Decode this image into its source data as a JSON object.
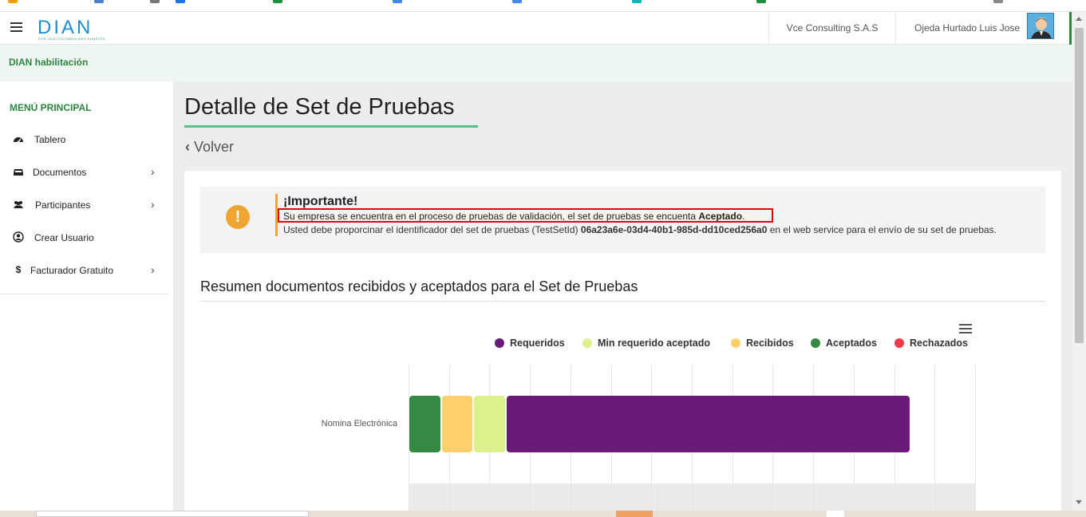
{
  "colors": {
    "brand_green": "#2e8540",
    "accent_teal": "#4ec28a",
    "warning_orange": "#f0a533",
    "highlight_red": "#e0060f"
  },
  "header": {
    "logo_text": "DIAN",
    "logo_tagline": "POR UNA COLOMBIA MÁS HONESTA",
    "company": "Vce Consulting S.A.S",
    "user": "Ojeda Hurtado Luis Jose",
    "menu_icon": "hamburger-icon",
    "avatar_icon": "user-avatar-icon"
  },
  "environment": "DIAN habilitación",
  "sidebar": {
    "title": "MENÚ PRINCIPAL",
    "items": [
      {
        "label": "Tablero",
        "icon": "dashboard-icon",
        "has_submenu": false
      },
      {
        "label": "Documentos",
        "icon": "inbox-icon",
        "has_submenu": true
      },
      {
        "label": "Participantes",
        "icon": "users-icon",
        "has_submenu": true
      },
      {
        "label": "Crear Usuario",
        "icon": "user-circle-icon",
        "has_submenu": false
      },
      {
        "label": "Facturador Gratuito",
        "icon": "dollar-icon",
        "has_submenu": true
      }
    ]
  },
  "main": {
    "title": "Detalle de Set de Pruebas",
    "back_label": "Volver",
    "alert": {
      "icon": "exclamation-icon",
      "title": "¡Importante!",
      "line1_text": "Su empresa se encuentra en el proceso de pruebas de validación, el set de pruebas se encuenta ",
      "line1_status": "Aceptado",
      "line1_end": ".",
      "line2_text": "Usted debe proporcinar el identificador del set de pruebas (TestSetId) ",
      "line2_id": "06a23a6e-03d4-40b1-985d-dd10ced256a0",
      "line2_end": " en el web service para el envío de su set de pruebas."
    },
    "summary_title": "Resumen documentos recibidos y aceptados para el Set de Pruebas",
    "chart_menu_icon": "chart-menu-icon"
  },
  "chart_data": {
    "type": "bar",
    "orientation": "horizontal",
    "stacked": true,
    "categories": [
      "Nomina Electrónica"
    ],
    "series": [
      {
        "name": "Requeridos",
        "color": "#6a1b7a",
        "values": [
          10
        ]
      },
      {
        "name": "Min requerido aceptado",
        "color": "#dcf08c",
        "values": [
          0.8
        ]
      },
      {
        "name": "Recibidos",
        "color": "#fdd06b",
        "values": [
          0.8
        ]
      },
      {
        "name": "Aceptados",
        "color": "#348a42",
        "values": [
          0.8
        ]
      },
      {
        "name": "Rechazados",
        "color": "#ef3b4c",
        "values": [
          0
        ]
      }
    ],
    "stack_order": [
      "Aceptados",
      "Recibidos",
      "Min requerido aceptado",
      "Requeridos",
      "Rechazados"
    ],
    "xlim": [
      0,
      14
    ],
    "grid": true,
    "legend_position": "top-right"
  }
}
